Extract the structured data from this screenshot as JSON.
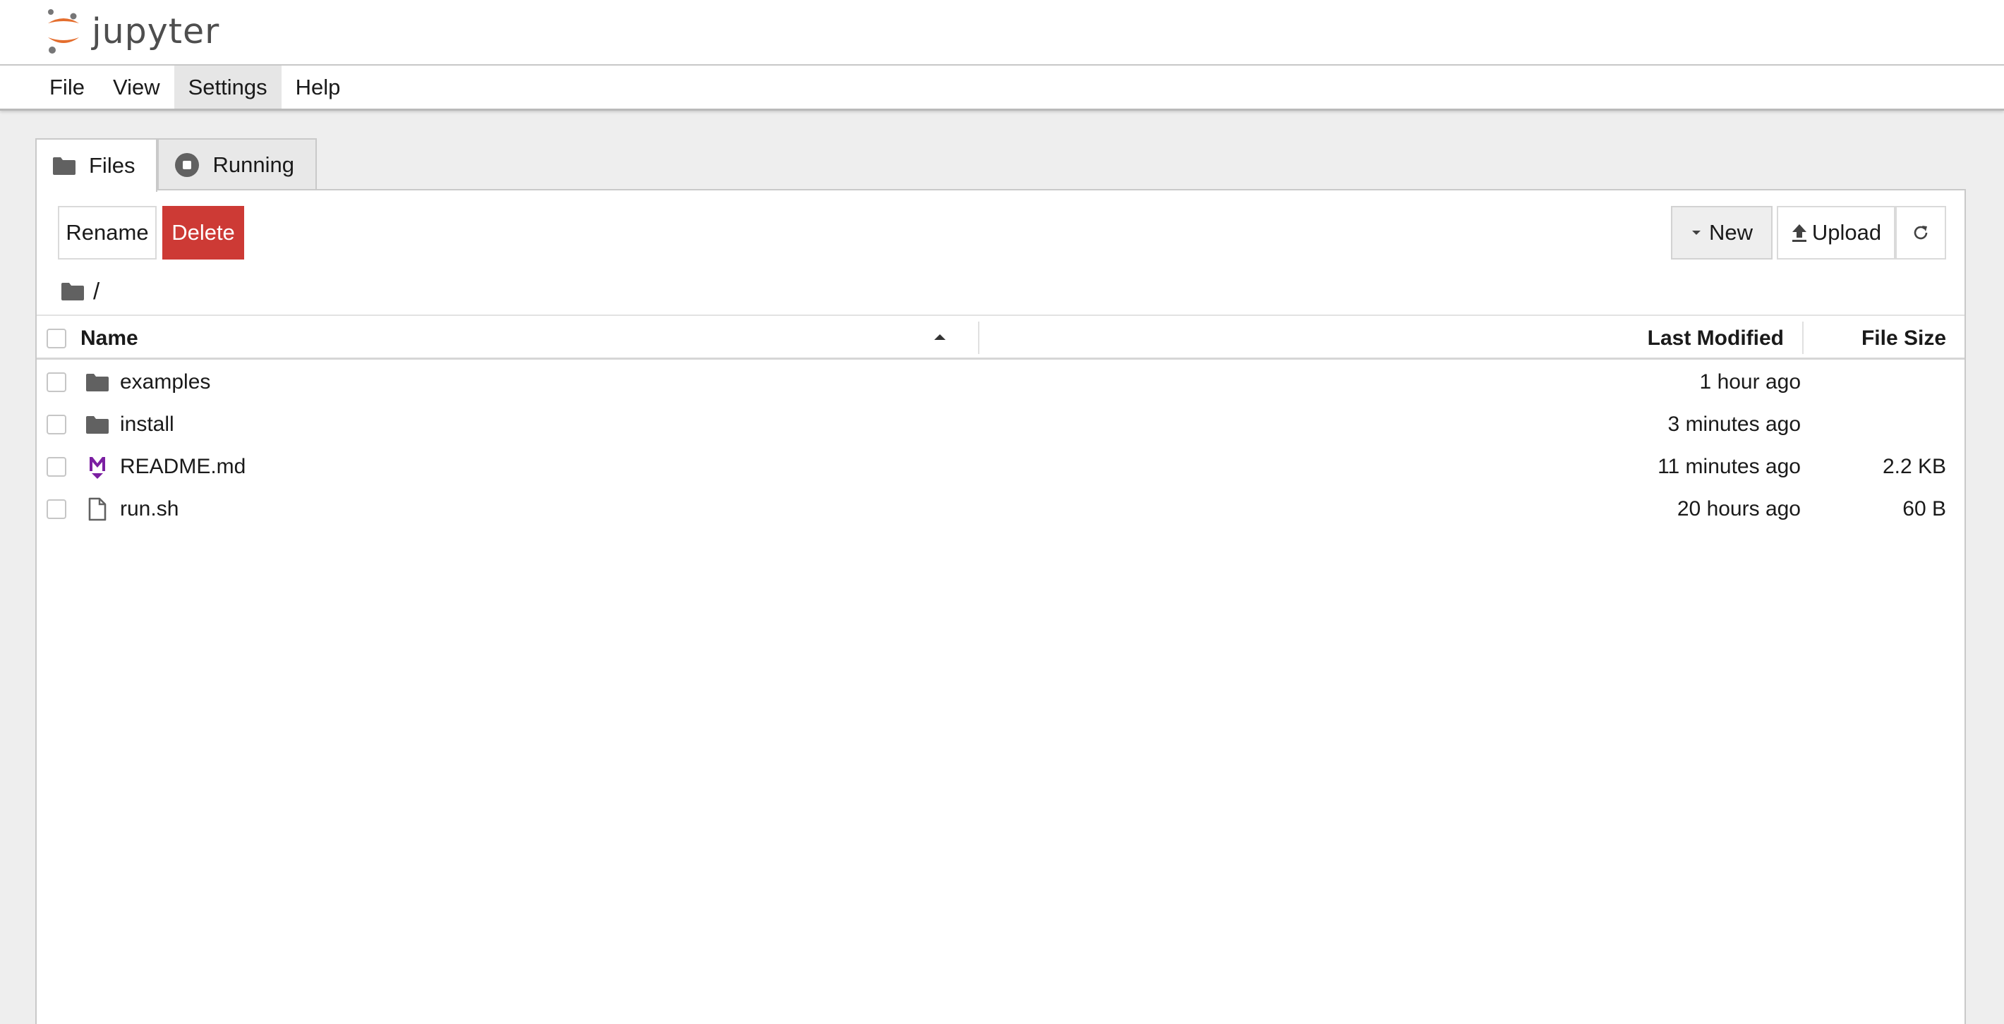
{
  "app": {
    "logo_text": "jupyter"
  },
  "menu": {
    "items": [
      "File",
      "View",
      "Settings",
      "Help"
    ],
    "active": "Settings"
  },
  "tabs": [
    {
      "label": "Files",
      "icon": "folder-icon",
      "active": true
    },
    {
      "label": "Running",
      "icon": "stop-circle-icon",
      "active": false
    }
  ],
  "toolbar": {
    "rename_label": "Rename",
    "delete_label": "Delete",
    "new_label": "New",
    "upload_label": "Upload",
    "refresh_icon": "refresh-icon",
    "delete_color": "#cd3a35"
  },
  "breadcrumb": {
    "path": "/"
  },
  "table": {
    "headers": {
      "name": "Name",
      "last_modified": "Last Modified",
      "file_size": "File Size"
    },
    "sort": {
      "column": "Name",
      "direction": "ascending"
    },
    "rows": [
      {
        "icon": "folder-icon",
        "name": "examples",
        "modified": "1 hour ago",
        "size": ""
      },
      {
        "icon": "folder-icon",
        "name": "install",
        "modified": "3 minutes ago",
        "size": ""
      },
      {
        "icon": "markdown-icon",
        "name": "README.md",
        "modified": "11 minutes ago",
        "size": "2.2 KB"
      },
      {
        "icon": "file-icon",
        "name": "run.sh",
        "modified": "20 hours ago",
        "size": "60 B"
      }
    ]
  },
  "colors": {
    "jupyter_orange": "#e46e2e",
    "markdown_purple": "#7b1fa2",
    "icon_gray": "#616161"
  }
}
